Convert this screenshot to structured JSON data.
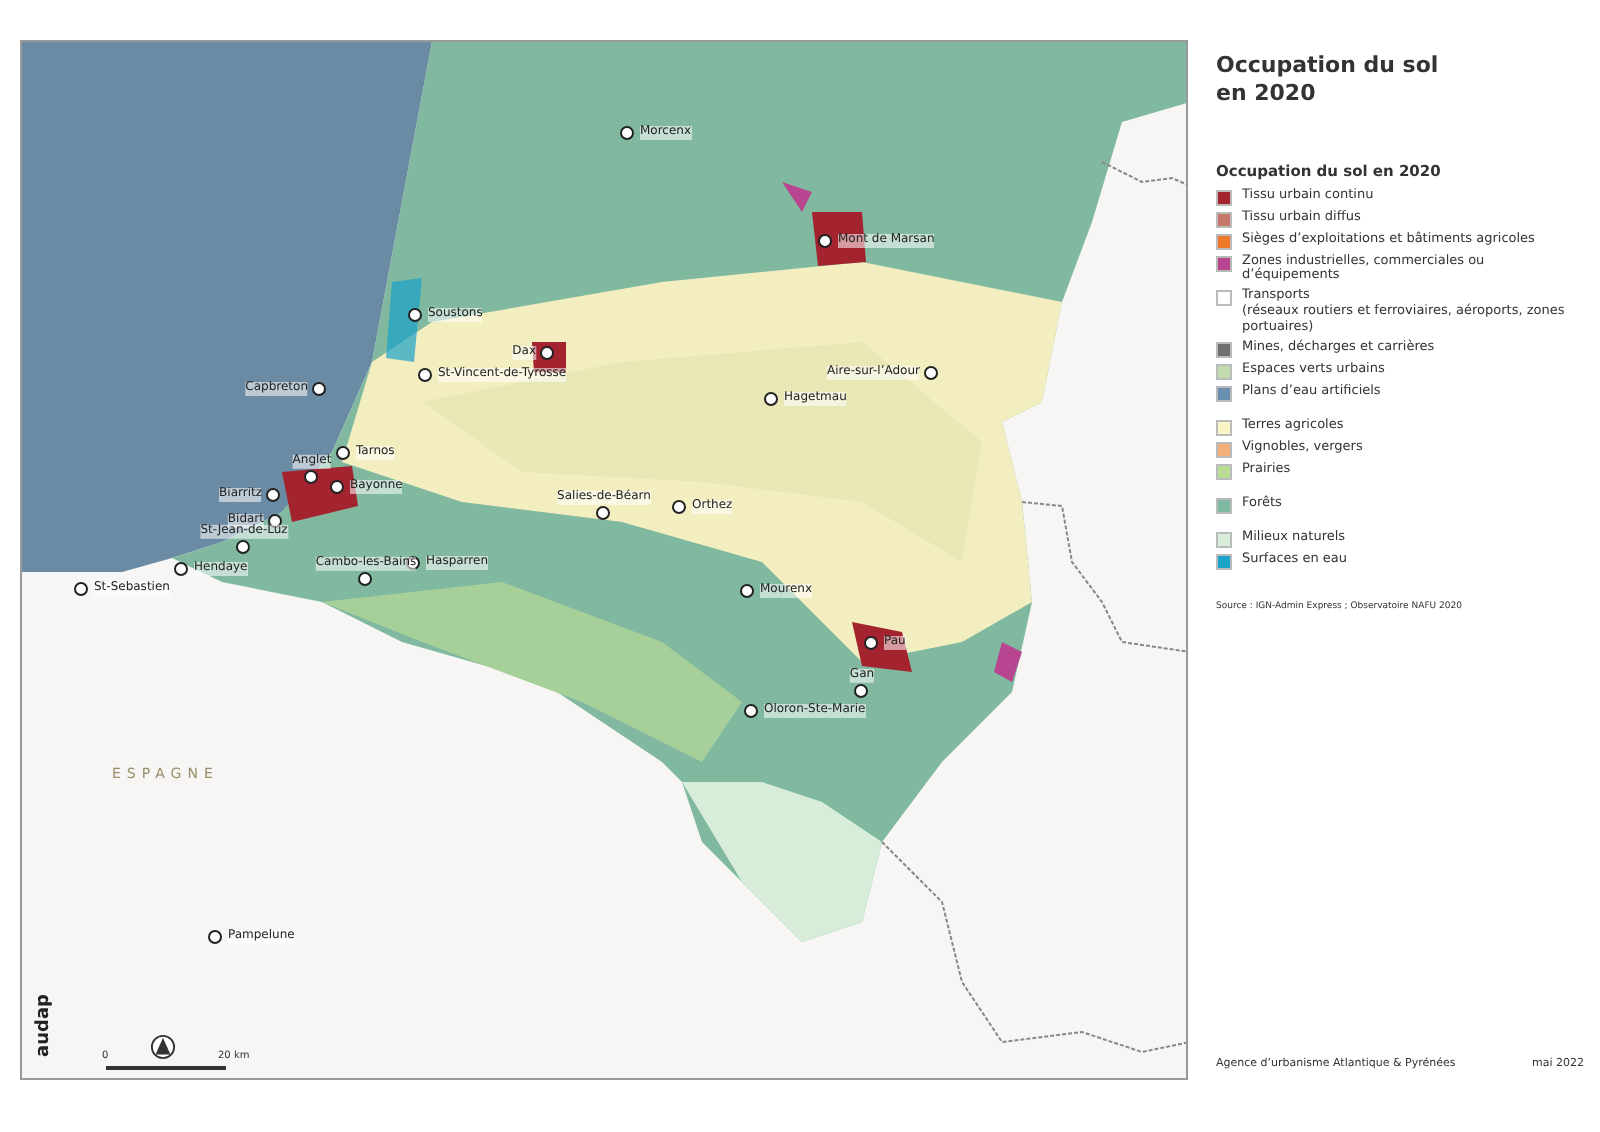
{
  "title": "Occupation du sol en 2020",
  "legend": {
    "title": "Occupation du sol en 2020",
    "groups": [
      [
        {
          "label": "Tissu urbain continu",
          "color": "#a3232f"
        },
        {
          "label": "Tissu urbain diffus",
          "color": "#c9776b"
        },
        {
          "label": "Sièges d’exploitations et bâtiments agricoles",
          "color": "#f0782a"
        },
        {
          "label": "Zones industrielles, commerciales ou d’équipements",
          "color": "#b8458f"
        },
        {
          "label": "Transports",
          "note": "(réseaux routiers et ferroviaires, aéroports, zones portuaires)",
          "color": "#ffffff"
        },
        {
          "label": "Mines, décharges et carrières",
          "color": "#6e6e6e"
        },
        {
          "label": "Espaces verts urbains",
          "color": "#c3d9ae"
        },
        {
          "label": "Plans d’eau artificiels",
          "color": "#6a8fb0"
        }
      ],
      [
        {
          "label": "Terres agricoles",
          "color": "#f8f3c4"
        },
        {
          "label": "Vignobles, vergers",
          "color": "#f5b07a"
        },
        {
          "label": "Prairies",
          "color": "#b7dc94"
        }
      ],
      [
        {
          "label": "Forêts",
          "color": "#7fb9a0"
        }
      ],
      [
        {
          "label": "Milieux naturels",
          "color": "#d7ecd9"
        },
        {
          "label": "Surfaces en eau",
          "color": "#1aa3c9"
        }
      ]
    ]
  },
  "source": "Source : IGN-Admin Express ; Observatoire NAFU 2020",
  "map": {
    "cities": [
      {
        "name": "Morcenx"
      },
      {
        "name": "Mont de Marsan"
      },
      {
        "name": "Soustons"
      },
      {
        "name": "Dax"
      },
      {
        "name": "Capbreton"
      },
      {
        "name": "St-Vincent-de-Tyrosse"
      },
      {
        "name": "Aire-sur-l’Adour"
      },
      {
        "name": "Hagetmau"
      },
      {
        "name": "Tarnos"
      },
      {
        "name": "Anglet"
      },
      {
        "name": "Biarritz"
      },
      {
        "name": "Bayonne"
      },
      {
        "name": "Bidart"
      },
      {
        "name": "St-Jean-de-Luz"
      },
      {
        "name": "Hendaye"
      },
      {
        "name": "St-Sebastien"
      },
      {
        "name": "Hasparren"
      },
      {
        "name": "Cambo-les-Bains"
      },
      {
        "name": "Salies-de-Béarn"
      },
      {
        "name": "Orthez"
      },
      {
        "name": "Mourenx"
      },
      {
        "name": "Pau"
      },
      {
        "name": "Gan"
      },
      {
        "name": "Oloron-Ste-Marie"
      },
      {
        "name": "Pampelune"
      }
    ],
    "country": "ESPAGNE",
    "scale": {
      "start": "0",
      "end": "20 km"
    },
    "logo": "audap"
  },
  "footer": {
    "agency": "Agence d’urbanisme Atlantique & Pyrénées",
    "date": "mai 2022"
  }
}
